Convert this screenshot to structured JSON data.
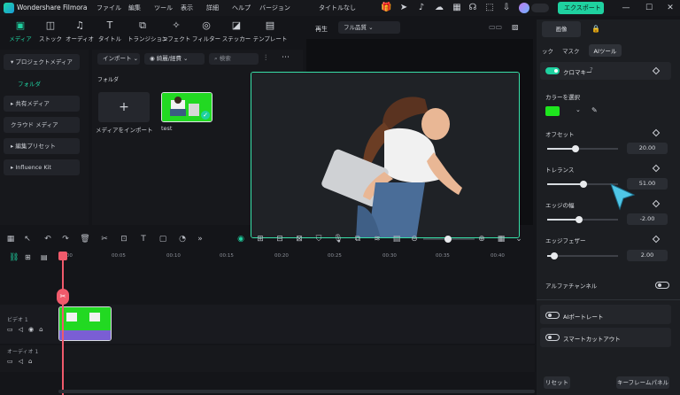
{
  "app": {
    "name": "Wondershare Filmora",
    "project_title": "タイトルなし"
  },
  "menu": [
    "ファイル",
    "編集",
    "ツール",
    "表示",
    "詳細",
    "ヘルプ",
    "バージョン"
  ],
  "export_label": "エクスポート",
  "media_tabs": [
    {
      "label": "メディア",
      "icon": "media-icon"
    },
    {
      "label": "ストック",
      "icon": "stock-icon"
    },
    {
      "label": "オーディオ",
      "icon": "music-note-icon"
    },
    {
      "label": "タイトル",
      "icon": "title-icon"
    },
    {
      "label": "トランジション",
      "icon": "transition-icon"
    },
    {
      "label": "エフェクト",
      "icon": "effects-icon"
    },
    {
      "label": "フィルター",
      "icon": "filter-icon"
    },
    {
      "label": "ステッカー",
      "icon": "sticker-icon"
    },
    {
      "label": "テンプレート",
      "icon": "template-icon"
    }
  ],
  "left_nav": {
    "project_media": "プロジェクトメディア",
    "folder": "フォルダ",
    "shared_media": "共有メディア",
    "cloud_media": "クラウド メディア",
    "edit_presets": "編集プリセット",
    "influence_kit": "Influence Kit"
  },
  "media_panel": {
    "import_label": "インポート",
    "sort_label": "綺麗/経費",
    "search_placeholder": "検索",
    "folder_heading": "フォルダ",
    "import_card_label": "メディアをインポート",
    "clip_name": "test"
  },
  "player": {
    "play_label": "再生",
    "quality": "フル品質"
  },
  "timeline": {
    "ticks": [
      "00:00",
      "00:05",
      "00:10",
      "00:15",
      "00:20",
      "00:25",
      "00:30",
      "00:35",
      "00:40"
    ],
    "video_track": "ビデオ 1",
    "audio_track": "オーディオ 1"
  },
  "right_panel": {
    "tab_video": "画像",
    "sub_tabs": [
      "ック",
      "マスク",
      "AIツール"
    ],
    "chroma_key": "クロマキー",
    "color_select": "カラーを選択",
    "color_value": "#1ee61e",
    "offset_label": "オフセット",
    "offset_value": "20.00",
    "offset_level": 0.4,
    "tolerance_label": "トレランス",
    "tolerance_value": "51.00",
    "tolerance_level": 0.51,
    "edge_width_label": "エッジの幅",
    "edge_width_value": "-2.00",
    "edge_width_level": 0.45,
    "edge_feather_label": "エッジフェザー",
    "edge_feather_value": "2.00",
    "edge_feather_level": 0.1,
    "alpha_label": "アルファチャンネル",
    "ai_portrait": "AIポートレート",
    "smart_cutout": "スマートカットアウト",
    "reset": "リセット",
    "keyframe_panel": "キーフレームパネル"
  },
  "colors": {
    "accent": "#1fd1a0",
    "green_screen": "#22d922",
    "playhead": "#f05a6b"
  }
}
